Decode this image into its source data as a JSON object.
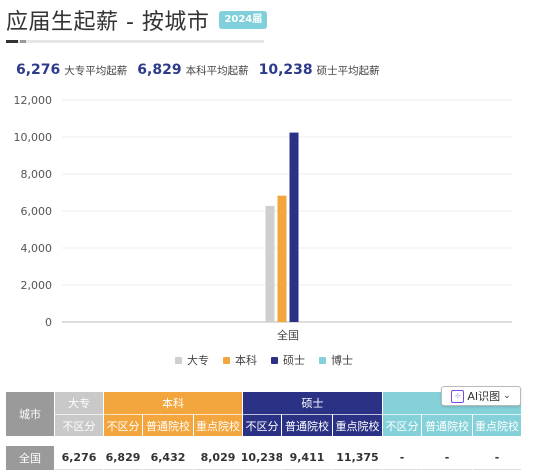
{
  "header": {
    "title": "应届生起薪 - 按城市",
    "badge": "2024届"
  },
  "summary": [
    {
      "value": "6,276",
      "label": "大专平均起薪"
    },
    {
      "value": "6,829",
      "label": "本科平均起薪"
    },
    {
      "value": "10,238",
      "label": "硕士平均起薪"
    }
  ],
  "colors": {
    "dazhuan": "#cfcfcf",
    "benke": "#f3a63d",
    "shuoshi": "#2b3286",
    "boshi": "#85d1d9"
  },
  "chart_data": {
    "type": "bar",
    "categories": [
      "全国"
    ],
    "series": [
      {
        "name": "大专",
        "values": [
          6276
        ]
      },
      {
        "name": "本科",
        "values": [
          6829
        ]
      },
      {
        "name": "硕士",
        "values": [
          10238
        ]
      },
      {
        "name": "博士",
        "values": [
          null
        ]
      }
    ],
    "yticks": [
      "0",
      "2,000",
      "4,000",
      "6,000",
      "8,000",
      "10,000",
      "12,000"
    ],
    "ylim": [
      0,
      12000
    ],
    "legend": "bottom",
    "grid": true
  },
  "table": {
    "city_header": "城市",
    "groups": [
      {
        "label": "大专",
        "subs": [
          "不区分"
        ]
      },
      {
        "label": "本科",
        "subs": [
          "不区分",
          "普通院校",
          "重点院校"
        ]
      },
      {
        "label": "硕士",
        "subs": [
          "不区分",
          "普通院校",
          "重点院校"
        ]
      },
      {
        "label": "博士",
        "subs": [
          "不区分",
          "普通院校",
          "重点院校"
        ]
      }
    ],
    "row": {
      "city": "全国",
      "values": [
        "6,276",
        "6,829",
        "6,432",
        "8,029",
        "10,238",
        "9,411",
        "11,375",
        "-",
        "-",
        "-"
      ]
    }
  },
  "ai_button": {
    "label": "AI识图",
    "icon": "scan-icon"
  }
}
